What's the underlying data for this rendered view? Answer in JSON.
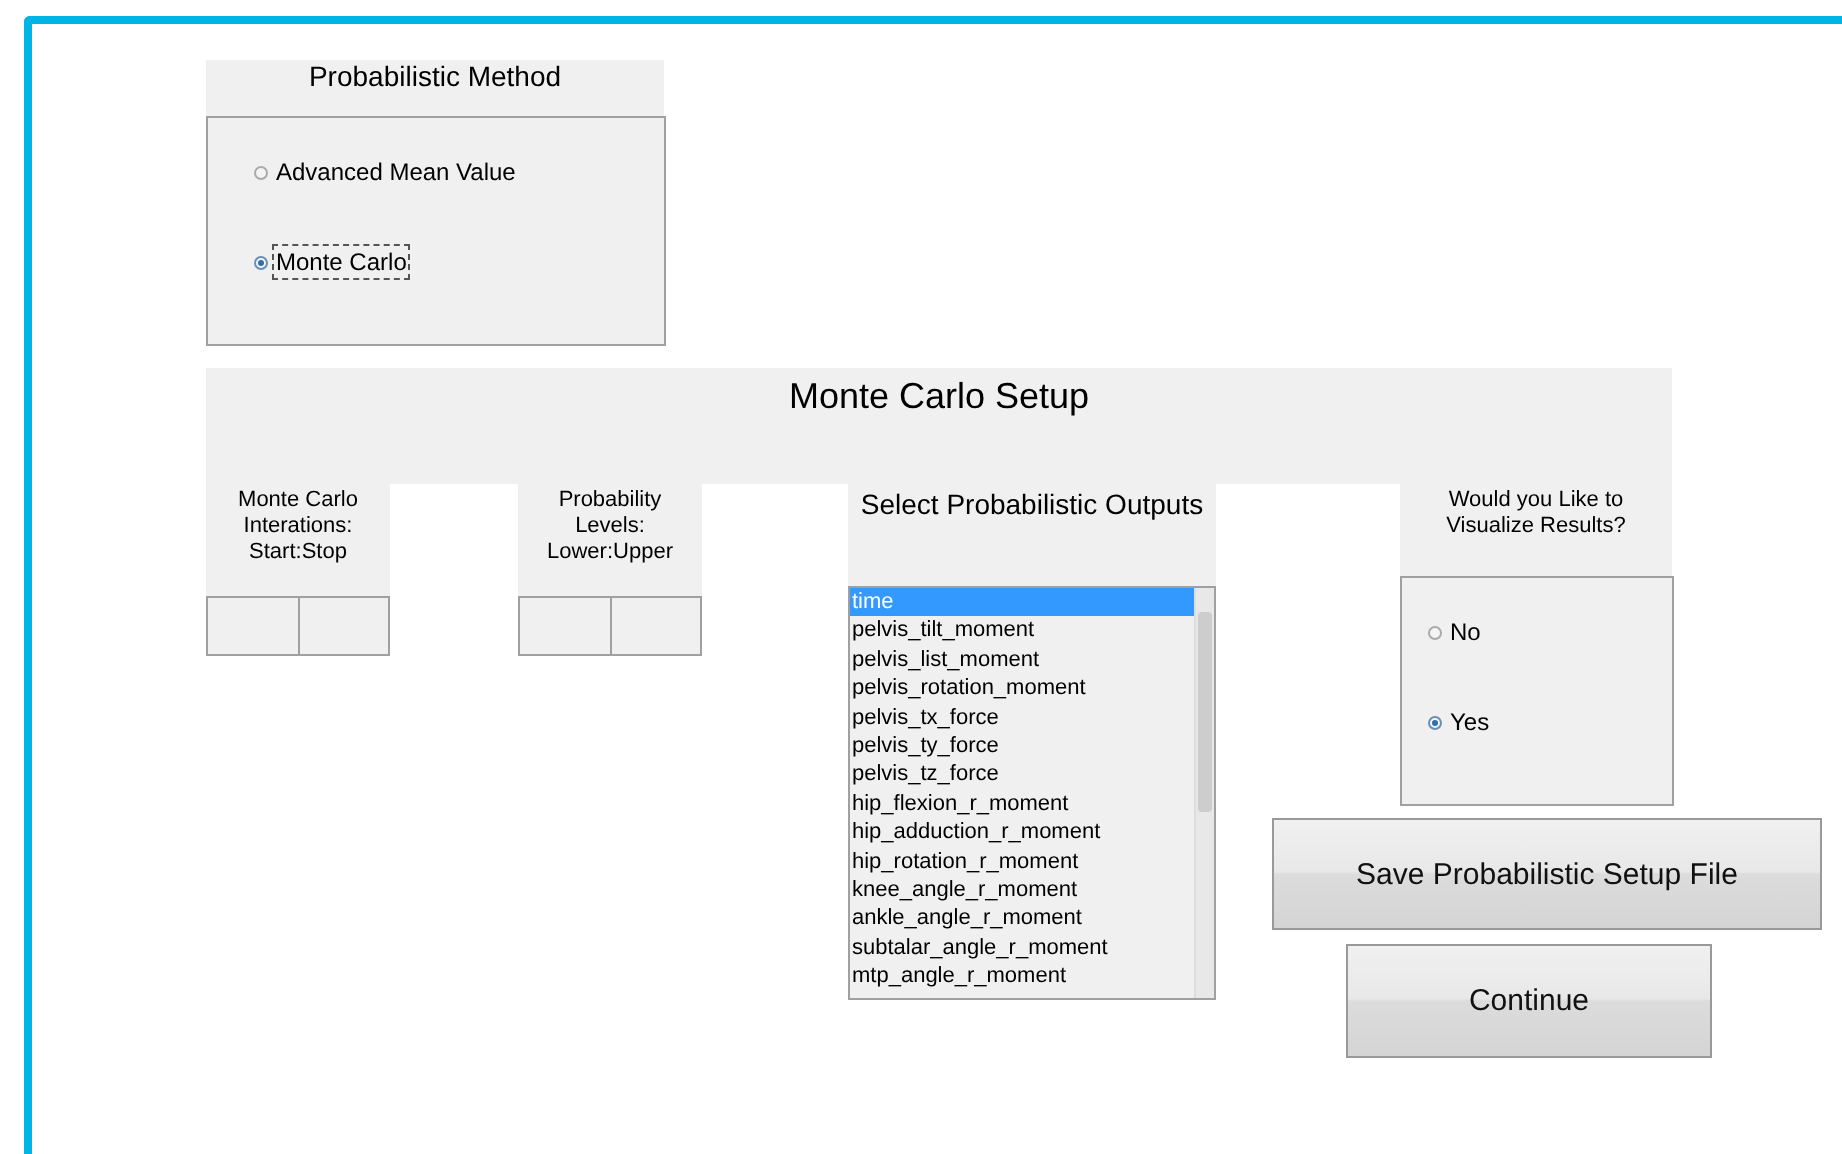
{
  "probabilistic_method": {
    "title": "Probabilistic Method",
    "options": [
      {
        "label": "Advanced Mean Value",
        "selected": false,
        "focused": false
      },
      {
        "label": "Monte Carlo",
        "selected": true,
        "focused": true
      }
    ]
  },
  "monte_carlo_setup": {
    "title": "Monte Carlo Setup",
    "iterations": {
      "label": "Monte Carlo\nInterations:\nStart:Stop"
    },
    "probability_levels": {
      "label": "Probability\nLevels:\nLower:Upper"
    },
    "outputs": {
      "label": "Select Probabilistic Outputs",
      "items": [
        {
          "label": "time",
          "selected": true
        },
        {
          "label": "pelvis_tilt_moment",
          "selected": false
        },
        {
          "label": "pelvis_list_moment",
          "selected": false
        },
        {
          "label": "pelvis_rotation_moment",
          "selected": false
        },
        {
          "label": "pelvis_tx_force",
          "selected": false
        },
        {
          "label": "pelvis_ty_force",
          "selected": false
        },
        {
          "label": "pelvis_tz_force",
          "selected": false
        },
        {
          "label": "hip_flexion_r_moment",
          "selected": false
        },
        {
          "label": "hip_adduction_r_moment",
          "selected": false
        },
        {
          "label": "hip_rotation_r_moment",
          "selected": false
        },
        {
          "label": "knee_angle_r_moment",
          "selected": false
        },
        {
          "label": "ankle_angle_r_moment",
          "selected": false
        },
        {
          "label": "subtalar_angle_r_moment",
          "selected": false
        },
        {
          "label": "mtp_angle_r_moment",
          "selected": false
        }
      ]
    },
    "visualize": {
      "label": "Would you Like to\nVisualize Results?",
      "options": [
        {
          "label": "No",
          "selected": false
        },
        {
          "label": "Yes",
          "selected": true
        }
      ]
    }
  },
  "buttons": [
    "Save Probabilistic Setup File",
    "Continue"
  ]
}
